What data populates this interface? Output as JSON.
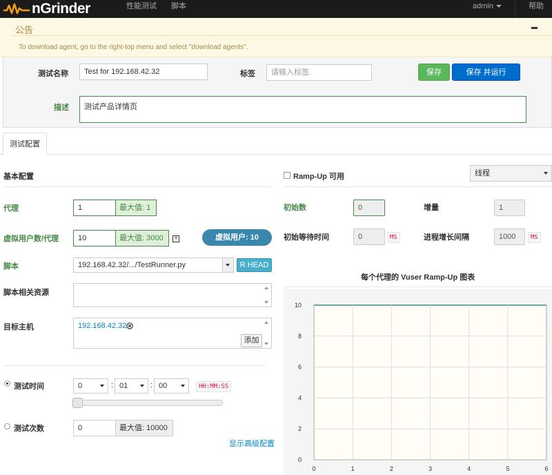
{
  "nav": {
    "brand": "nGrinder",
    "items": [
      {
        "label": "性能测试"
      },
      {
        "label": "脚本"
      }
    ],
    "user": "admin",
    "help": "帮助"
  },
  "notice": {
    "title": "公告",
    "text": "To download agent, go to the right-top menu and select \"download agents\"."
  },
  "test": {
    "name_label": "测试名称",
    "name_value": "Test for 192.168.42.32",
    "tag_label": "标签",
    "tag_placeholder": "请输入标签.",
    "save_label": "保存",
    "save_run_label": "保存 并运行",
    "desc_label": "描述",
    "desc_value": "测试产品详情页"
  },
  "tabs": [
    {
      "label": "测试配置"
    }
  ],
  "basic": {
    "title": "基本配置",
    "agent_label": "代理",
    "agent_value": "1",
    "agent_max": "最大值: 1",
    "vuser_label": "虚拟用户数/代理",
    "vuser_value": "10",
    "vuser_max": "最大值: 3000",
    "vuser_total": "虚拟用户: 10",
    "script_label": "脚本",
    "script_value": "192.168.42.32/.../TestRunner.py",
    "script_head": "R HEAD",
    "resources_label": "脚本相关资源",
    "target_label": "目标主机",
    "target_host": "192.168.42.32",
    "add_label": "添加",
    "duration_label": "测试时间",
    "duration_h": "0",
    "duration_m": "01",
    "duration_s": "00",
    "duration_colon": ":",
    "duration_format": "HH:MM:SS",
    "duration_slider": 0,
    "count_label": "测试次数",
    "count_value": "0",
    "count_max": "最大值: 10000",
    "advanced_link": "显示高级配置"
  },
  "rampup": {
    "enable_label": "Ramp-Up 可用",
    "enabled": false,
    "type_value": "线程",
    "initial_label": "初始数",
    "initial_value": "0",
    "step_label": "增量",
    "step_value": "1",
    "initial_sleep_label": "初始等待时间",
    "initial_sleep_value": "0",
    "interval_label": "进程增长间隔",
    "interval_value": "1000",
    "unit_ms": "MS",
    "chart_title": "每个代理的 Vuser Ramp-Up 图表"
  },
  "chart_data": {
    "type": "line",
    "title": "每个代理的 Vuser Ramp-Up 图表",
    "xlim": [
      0,
      6
    ],
    "ylim": [
      0,
      10
    ],
    "x_ticks": [
      "0",
      "1",
      "2",
      "3",
      "4",
      "5",
      "6"
    ],
    "y_ticks": [
      "0",
      "2",
      "4",
      "6",
      "8",
      "10"
    ],
    "series": [],
    "grid": true
  }
}
